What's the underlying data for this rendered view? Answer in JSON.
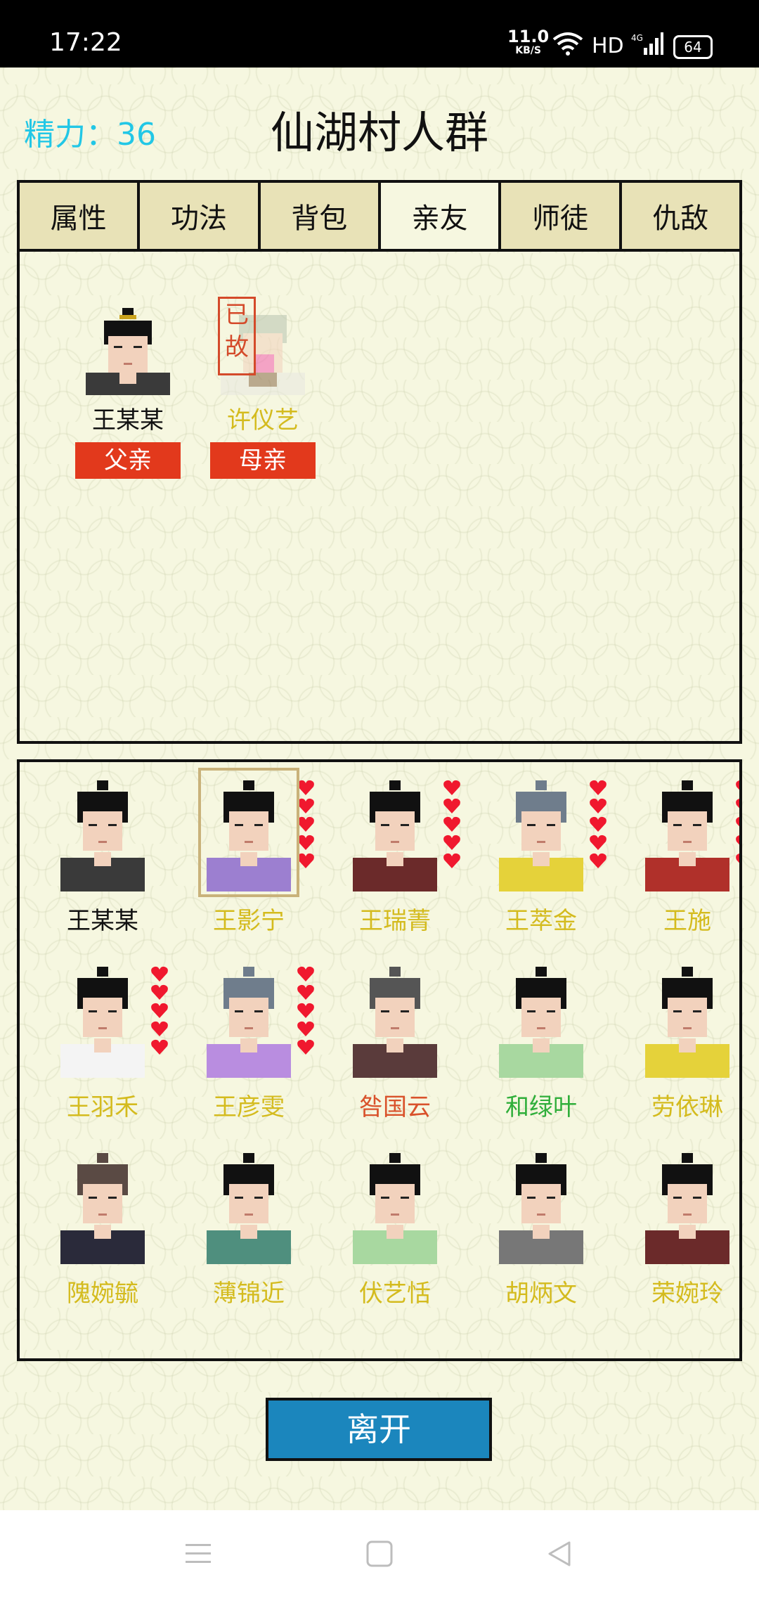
{
  "status": {
    "time": "17:22",
    "net_speed": "11.0",
    "net_unit": "KB/S",
    "hd": "HD",
    "battery": "64"
  },
  "header": {
    "energy": "精力：36",
    "title": "仙湖村人群"
  },
  "tabs": [
    {
      "label": "属性",
      "active": false
    },
    {
      "label": "功法",
      "active": false
    },
    {
      "label": "背包",
      "active": false
    },
    {
      "label": "亲友",
      "active": true
    },
    {
      "label": "师徒",
      "active": false
    },
    {
      "label": "仇敌",
      "active": false
    }
  ],
  "family": [
    {
      "name": "王某某",
      "role": "父亲",
      "color": "#111111"
    },
    {
      "name": "许仪艺",
      "role": "母亲",
      "color": "#d4bb1e",
      "deceased_label": "已故"
    }
  ],
  "people": [
    {
      "name": "王某某",
      "color": "#111111",
      "hearts": 0,
      "hair": "#111",
      "cloth": "#3a3a3a"
    },
    {
      "name": "王影宁",
      "color": "#d4bb1e",
      "hearts": 5,
      "hair": "#111",
      "cloth": "#9c7fd0",
      "selected": true
    },
    {
      "name": "王瑞菁",
      "color": "#d4bb1e",
      "hearts": 5,
      "hair": "#111",
      "cloth": "#6b2a2a"
    },
    {
      "name": "王萃金",
      "color": "#d4bb1e",
      "hearts": 5,
      "hair": "#6f7d8c",
      "cloth": "#e5d23a"
    },
    {
      "name": "王施",
      "color": "#d4bb1e",
      "hearts": 5,
      "hair": "#111",
      "cloth": "#b0302a"
    },
    {
      "name": "王羽禾",
      "color": "#d4bb1e",
      "hearts": 5,
      "hair": "#111",
      "cloth": "#f4f4f4"
    },
    {
      "name": "王彦雯",
      "color": "#d4bb1e",
      "hearts": 5,
      "hair": "#6f7d8c",
      "cloth": "#b98de0"
    },
    {
      "name": "咎国云",
      "color": "#d9522b",
      "hearts": 0,
      "hair": "#555",
      "cloth": "#5a3b3b"
    },
    {
      "name": "和绿叶",
      "color": "#2fae3a",
      "hearts": 0,
      "hair": "#111",
      "cloth": "#a8d8a0"
    },
    {
      "name": "劳依琳",
      "color": "#d4bb1e",
      "hearts": 0,
      "hair": "#111",
      "cloth": "#e5d23a"
    },
    {
      "name": "隗婉毓",
      "color": "#d4bb1e",
      "hearts": 0,
      "hair": "#5a4a44",
      "cloth": "#2a2a3a"
    },
    {
      "name": "薄锦近",
      "color": "#d4bb1e",
      "hearts": 0,
      "hair": "#111",
      "cloth": "#4f8f7e"
    },
    {
      "name": "伏艺恬",
      "color": "#d4bb1e",
      "hearts": 0,
      "hair": "#111",
      "cloth": "#a8d8a0"
    },
    {
      "name": "胡炳文",
      "color": "#d4bb1e",
      "hearts": 0,
      "hair": "#111",
      "cloth": "#777777"
    },
    {
      "name": "荣婉玲",
      "color": "#d4bb1e",
      "hearts": 0,
      "hair": "#111",
      "cloth": "#6b2a2a"
    }
  ],
  "leave_label": "离开"
}
